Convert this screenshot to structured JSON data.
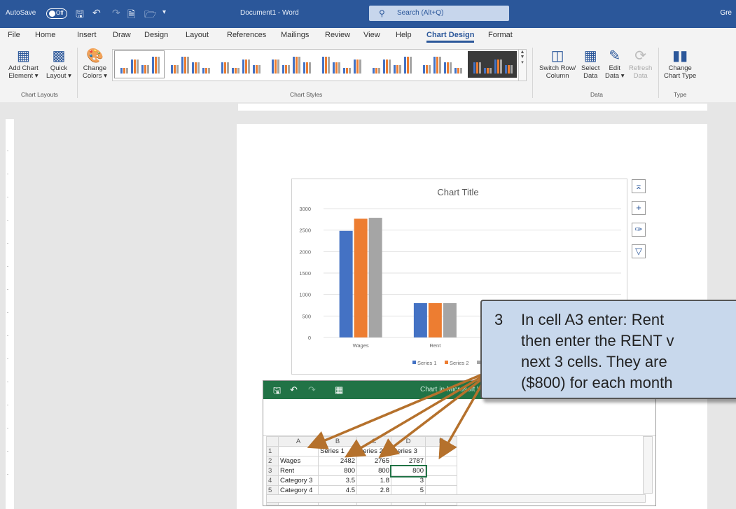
{
  "titlebar": {
    "autosave_label": "AutoSave",
    "autosave_state": "Off",
    "doc_title": "Document1  -  Word",
    "search_placeholder": "Search (Alt+Q)",
    "user": "Gre"
  },
  "menu": {
    "tabs": [
      "File",
      "Home",
      "Insert",
      "Draw",
      "Design",
      "Layout",
      "References",
      "Mailings",
      "Review",
      "View",
      "Help",
      "Chart Design",
      "Format"
    ],
    "active": "Chart Design"
  },
  "ribbon": {
    "add_chart_element": [
      "Add Chart",
      "Element ▾"
    ],
    "quick_layout": [
      "Quick",
      "Layout ▾"
    ],
    "change_colors": [
      "Change",
      "Colors ▾"
    ],
    "group_chart_layouts": "Chart Layouts",
    "group_chart_styles": "Chart Styles",
    "switch_row_col": [
      "Switch Row/",
      "Column"
    ],
    "select_data": [
      "Select",
      "Data"
    ],
    "edit_data": [
      "Edit",
      "Data ▾"
    ],
    "refresh_data": [
      "Refresh",
      "Data"
    ],
    "group_data": "Data",
    "change_chart_type": [
      "Change",
      "Chart Type"
    ],
    "group_type": "Type",
    "accent": "#2b579a"
  },
  "chart_data": {
    "type": "bar",
    "title": "Chart Title",
    "categories": [
      "Wages",
      "Rent",
      "Category 3",
      "Category 4"
    ],
    "visible_categories": [
      "Wages",
      "Rent"
    ],
    "series": [
      {
        "name": "Series 1",
        "values": [
          2482,
          800
        ],
        "color": "#4472c4"
      },
      {
        "name": "Series 2",
        "values": [
          2765,
          800
        ],
        "color": "#ed7d31"
      },
      {
        "name": "Series 3",
        "values": [
          2787,
          800
        ],
        "color": "#a5a5a5"
      }
    ],
    "ylim": [
      0,
      3000
    ],
    "yticks": [
      "0",
      "500",
      "1000",
      "1500",
      "2000",
      "2500",
      "3000"
    ],
    "grid": true,
    "legend": "bottom"
  },
  "excel": {
    "title": "Chart in Microsoft Word",
    "columns": [
      "",
      "A",
      "B",
      "C",
      "D",
      "E"
    ],
    "rows": [
      [
        "1",
        "",
        "Series 1",
        "Series 2",
        "Series 3",
        ""
      ],
      [
        "2",
        "Wages",
        "2482",
        "2765",
        "2787",
        ""
      ],
      [
        "3",
        "Rent",
        "800",
        "800",
        "800",
        ""
      ],
      [
        "4",
        "Category 3",
        "3.5",
        "1.8",
        "3",
        ""
      ],
      [
        "5",
        "Category 4",
        "4.5",
        "2.8",
        "5",
        ""
      ],
      [
        "6",
        "",
        "",
        "",
        "",
        ""
      ]
    ]
  },
  "callout": {
    "step": "3",
    "lines": [
      "In cell A3 enter:  Rent",
      "then enter the RENT v",
      "next 3 cells.  They are",
      "($800) for each month"
    ],
    "background": "#c8d8ec",
    "arrow_color": "#b5712c"
  }
}
